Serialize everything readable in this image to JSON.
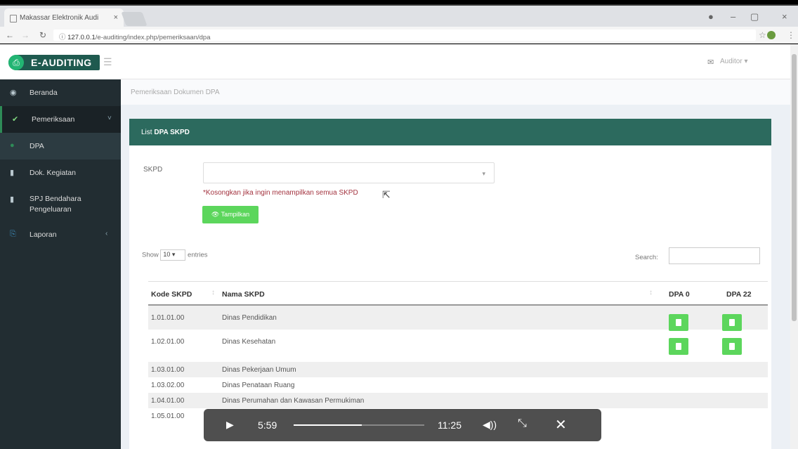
{
  "browser": {
    "tab_title": "Makassar Elektronik Audi",
    "url_host": "127.0.0.1",
    "url_path": "/e-auditing/index.php/pemeriksaan/dpa"
  },
  "app": {
    "logo": "E-AUDITING",
    "user_label": "Auditor ▾"
  },
  "sidebar": {
    "items": [
      {
        "label": "Beranda",
        "icon": "dashboard-icon"
      },
      {
        "label": "Pemeriksaan",
        "icon": "check-icon"
      },
      {
        "label": "DPA",
        "icon": "circle-icon"
      },
      {
        "label": "Dok. Kegiatan",
        "icon": "file-icon"
      },
      {
        "label": "SPJ Bendahara Pengeluaran",
        "icon": "file-icon"
      },
      {
        "label": "Laporan",
        "icon": "report-icon"
      }
    ]
  },
  "breadcrumb": "Pemeriksaan Dokumen DPA",
  "panel": {
    "title_prefix": "List",
    "title_bold": "DPA SKPD",
    "skpd_label": "SKPD",
    "skpd_value": "",
    "hint": "*Kosongkan jika ingin menampilkan semua SKPD",
    "show_button": "Tampilkan",
    "show_prefix": "Show",
    "entries_value": "10",
    "show_suffix": "entries",
    "search_label": "Search:"
  },
  "table": {
    "headers": [
      "Kode SKPD",
      "Nama SKPD",
      "DPA 0",
      "DPA 22"
    ],
    "rows": [
      {
        "kode": "1.01.01.00",
        "nama": "Dinas Pendidikan",
        "dpa0": true,
        "dpa22": true
      },
      {
        "kode": "1.02.01.00",
        "nama": "Dinas Kesehatan",
        "dpa0": true,
        "dpa22": true
      },
      {
        "kode": "1.03.01.00",
        "nama": "Dinas Pekerjaan Umum",
        "dpa0": false,
        "dpa22": false
      },
      {
        "kode": "1.03.02.00",
        "nama": "Dinas Penataan Ruang",
        "dpa0": false,
        "dpa22": false
      },
      {
        "kode": "1.04.01.00",
        "nama": "Dinas Perumahan dan Kawasan Permukiman",
        "dpa0": false,
        "dpa22": false
      },
      {
        "kode": "1.05.01.00",
        "nama": "",
        "dpa0": false,
        "dpa22": false
      }
    ]
  },
  "player": {
    "current": "5:59",
    "duration": "11:25",
    "progress": 0.524
  },
  "colors": {
    "header_green": "#2c6a5e",
    "button_green": "#5cd65c",
    "sidebar_bg": "#222d32",
    "hint_red": "#a3333f"
  }
}
